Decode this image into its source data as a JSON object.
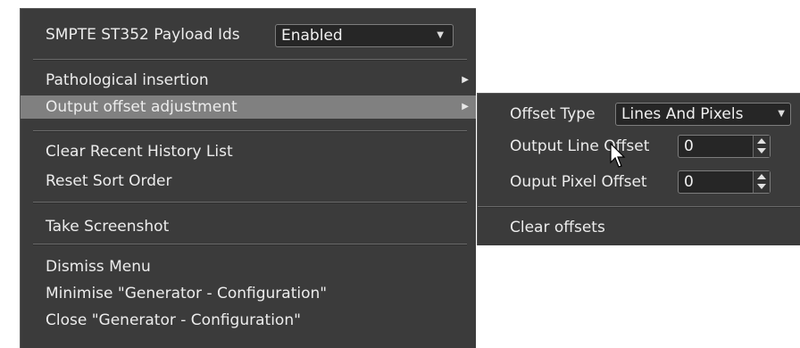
{
  "main_menu": {
    "payload_label": "SMPTE ST352 Payload Ids",
    "payload_value": "Enabled",
    "items": [
      {
        "label": "Pathological insertion"
      },
      {
        "label": "Output offset adjustment"
      },
      {
        "label": "Clear Recent History List"
      },
      {
        "label": "Reset Sort Order"
      },
      {
        "label": "Take Screenshot"
      },
      {
        "label": "Dismiss Menu"
      },
      {
        "label": "Minimise \"Generator - Configuration\""
      },
      {
        "label": "Close \"Generator - Configuration\""
      }
    ]
  },
  "submenu": {
    "offset_type_label": "Offset Type",
    "offset_type_value": "Lines And Pixels",
    "line_offset_label": "Output Line Offset",
    "line_offset_value": "0",
    "pixel_offset_label": "Ouput Pixel Offset",
    "pixel_offset_value": "0",
    "clear_label": "Clear offsets"
  },
  "colors": {
    "menu_bg": "#3b3b3b",
    "highlight": "#808080",
    "text": "#ececec"
  }
}
